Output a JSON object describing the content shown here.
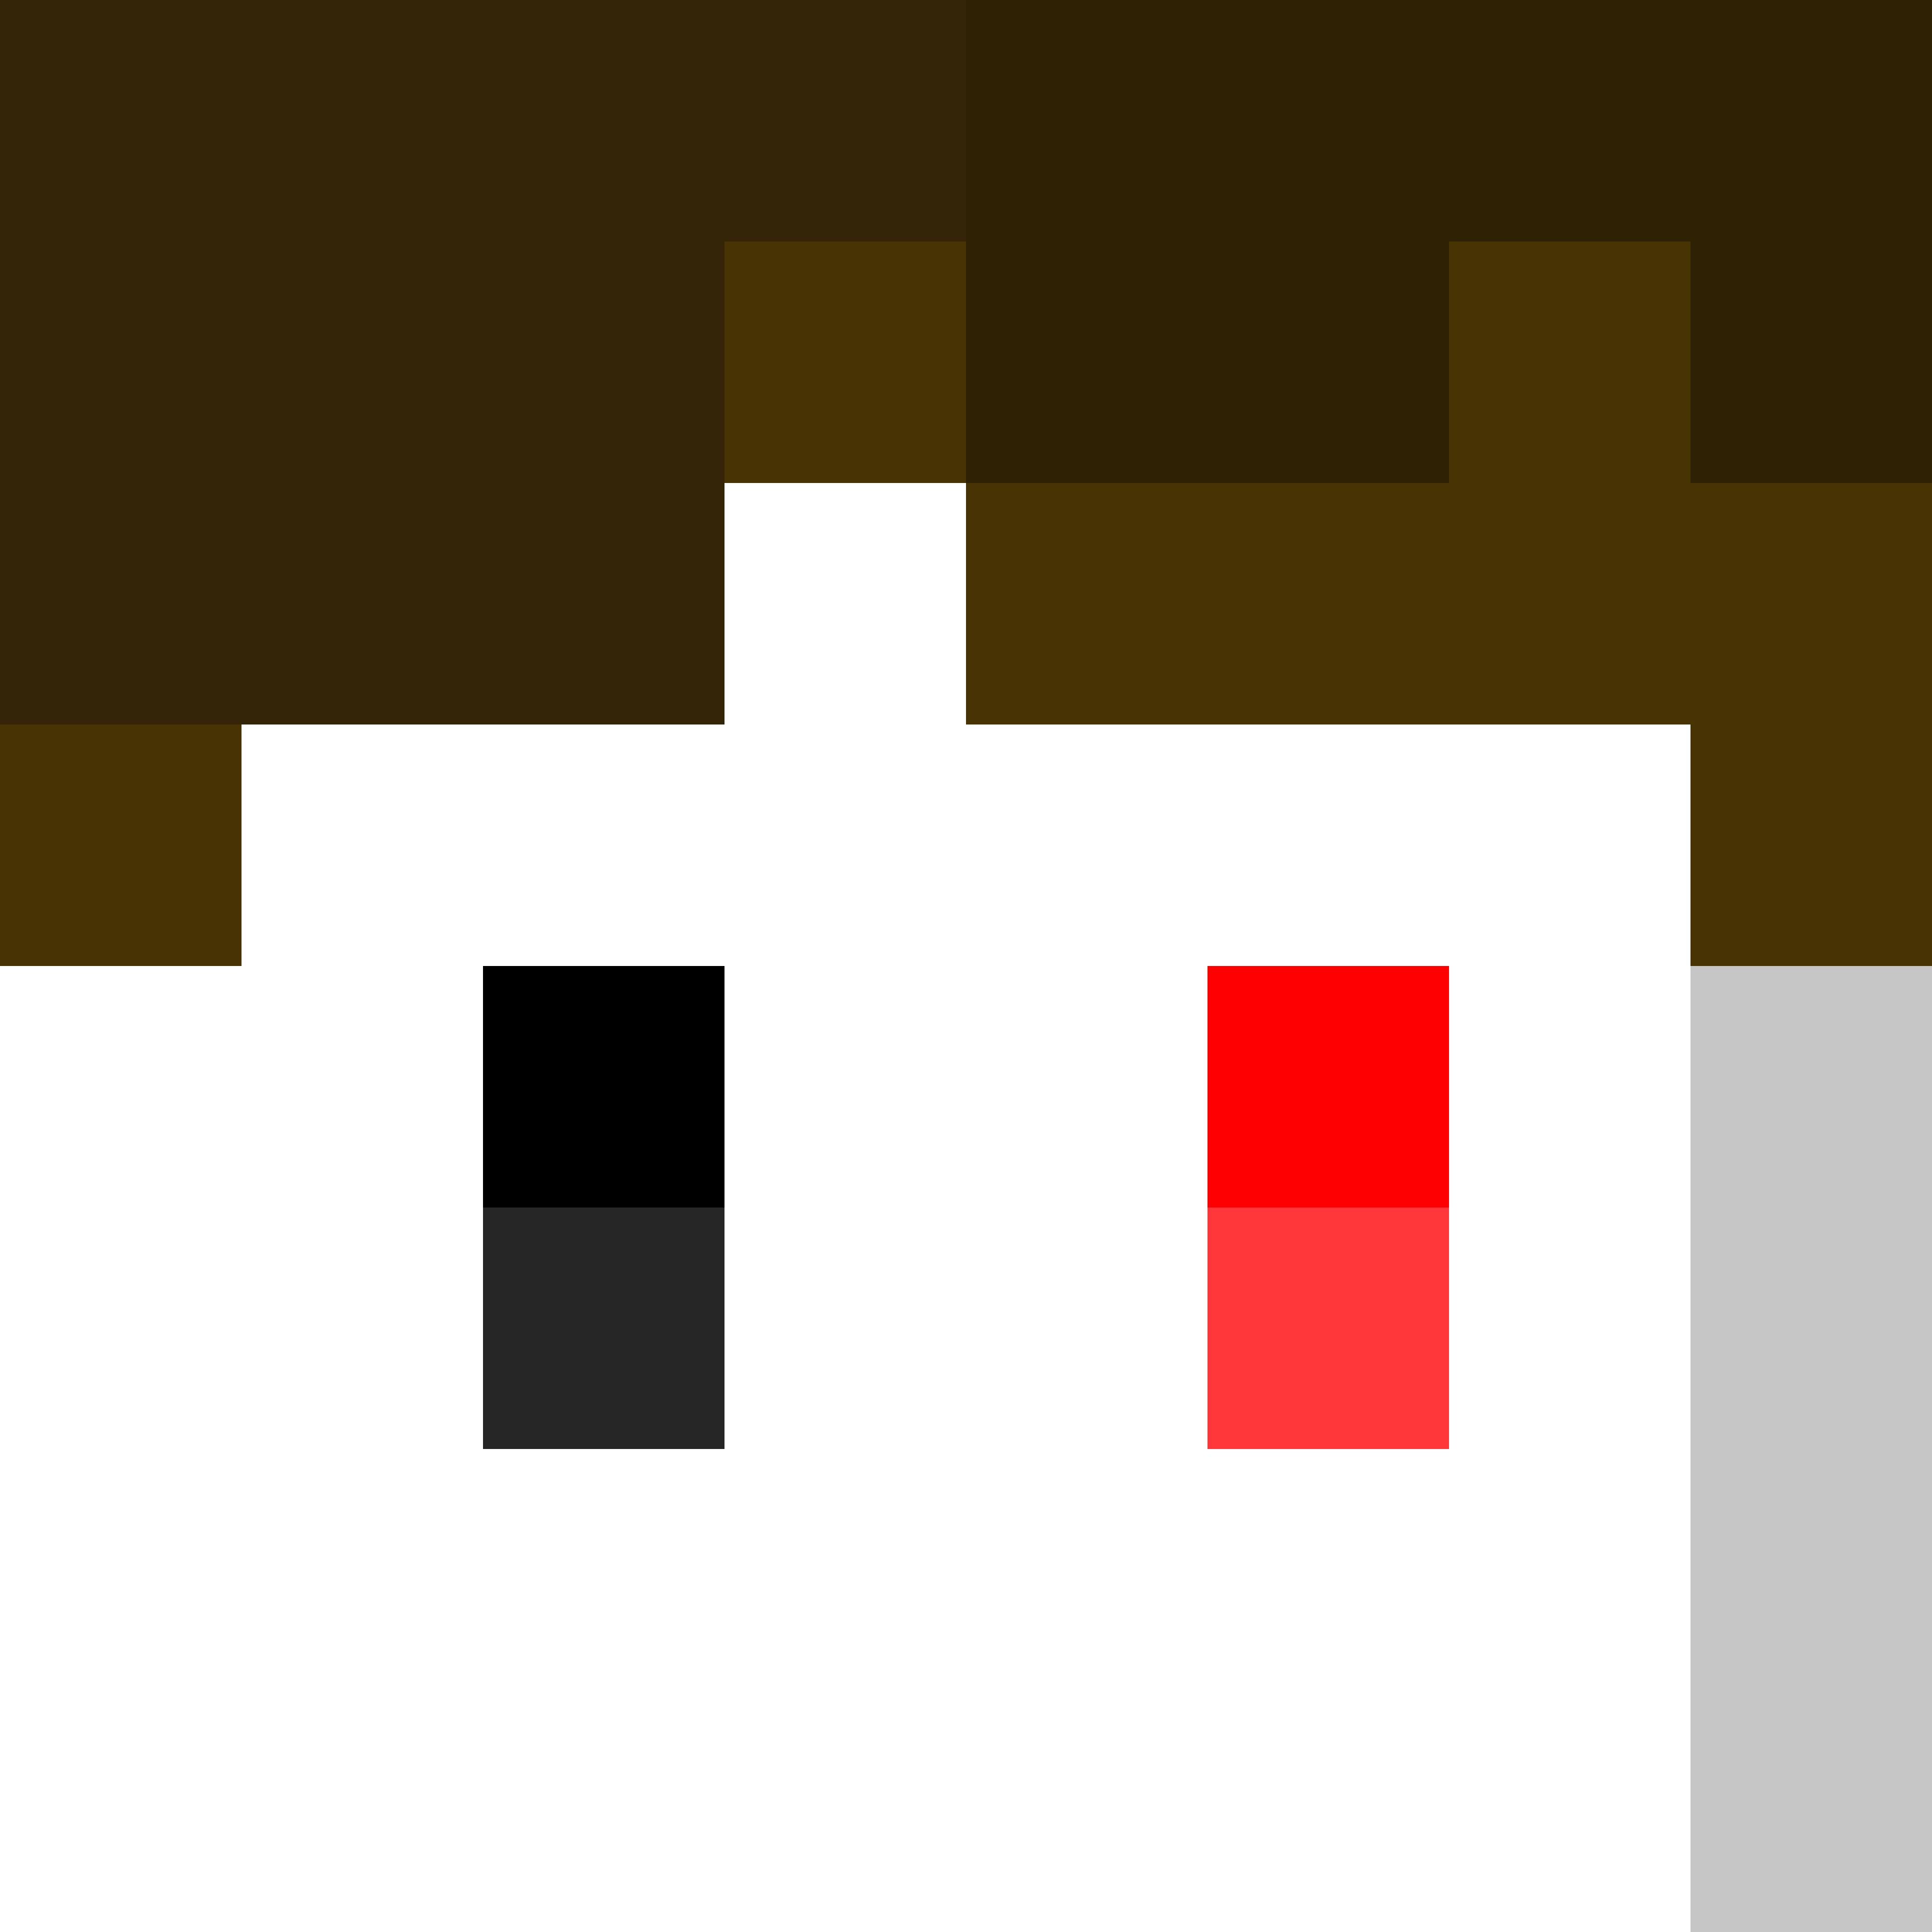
{
  "palette": {
    "hair_dark": "#332505",
    "hair_shade": "#2f2204",
    "hair_light": "#483302",
    "skin": "#ffffff",
    "left_eye_top": "#000000",
    "left_eye_bottom": "#262626",
    "right_eye_top": "#ff0000",
    "right_eye_bottom": "#ff3538",
    "side_shadow": "#c6c6c6"
  },
  "pixel_grid": {
    "cols": 8,
    "rows": 8,
    "rows_data": [
      [
        "hair_dark",
        "hair_dark",
        "hair_dark",
        "hair_dark",
        "hair_shade",
        "hair_shade",
        "hair_shade",
        "hair_shade"
      ],
      [
        "hair_dark",
        "hair_dark",
        "hair_dark",
        "hair_light",
        "hair_shade",
        "hair_shade",
        "hair_light",
        "hair_shade"
      ],
      [
        "hair_dark",
        "hair_dark",
        "hair_dark",
        "skin",
        "hair_light",
        "hair_light",
        "hair_light",
        "hair_light"
      ],
      [
        "hair_light",
        "skin",
        "skin",
        "skin",
        "skin",
        "skin",
        "skin",
        "hair_light"
      ],
      [
        "skin",
        "skin",
        "left_eye_top",
        "skin",
        "skin",
        "right_eye_top",
        "skin",
        "side_shadow"
      ],
      [
        "skin",
        "skin",
        "left_eye_bottom",
        "skin",
        "skin",
        "right_eye_bottom",
        "skin",
        "side_shadow"
      ],
      [
        "skin",
        "skin",
        "skin",
        "skin",
        "skin",
        "skin",
        "skin",
        "side_shadow"
      ],
      [
        "skin",
        "skin",
        "skin",
        "skin",
        "skin",
        "skin",
        "skin",
        "side_shadow"
      ]
    ]
  }
}
